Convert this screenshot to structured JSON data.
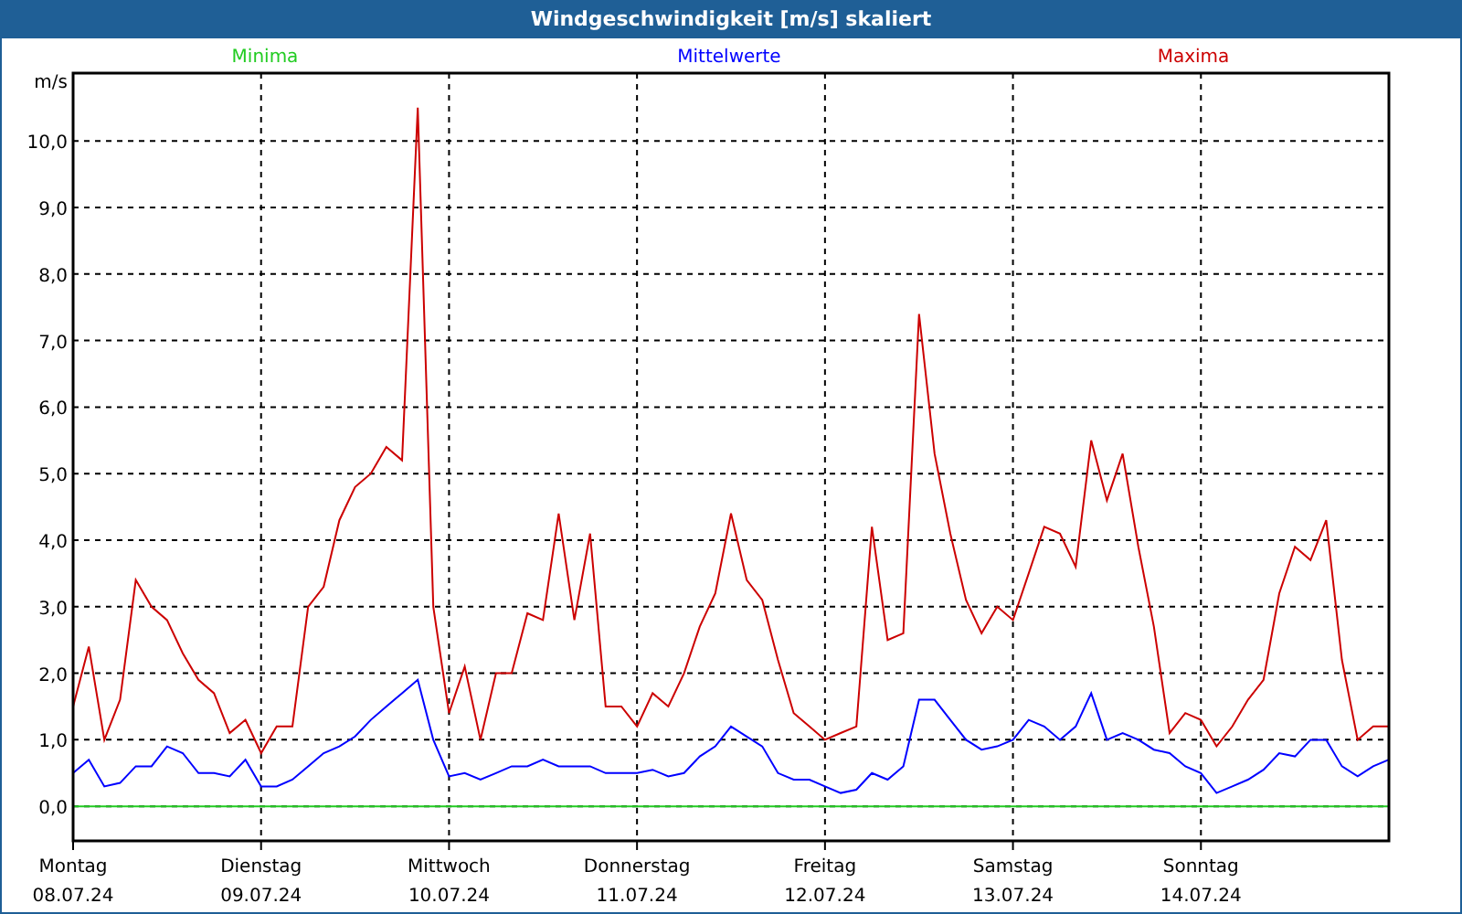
{
  "window": {
    "title": "Windgeschwindigkeit [m/s] skaliert"
  },
  "chart_data": {
    "type": "line",
    "ylabel": "m/s",
    "grid": true,
    "ylim": [
      -0.52,
      11.02
    ],
    "categories": [
      "Montag",
      null,
      null,
      null,
      null,
      null,
      null,
      null,
      null,
      null,
      null,
      null,
      "Dienstag",
      null,
      null,
      null,
      null,
      null,
      null,
      null,
      null,
      null,
      null,
      null,
      "Mittwoch",
      null,
      null,
      null,
      null,
      null,
      null,
      null,
      null,
      null,
      null,
      null,
      "Donnerstag",
      null,
      null,
      null,
      null,
      null,
      null,
      null,
      null,
      null,
      null,
      null,
      "Freitag",
      null,
      null,
      null,
      null,
      null,
      null,
      null,
      null,
      null,
      null,
      null,
      "Samstag",
      null,
      null,
      null,
      null,
      null,
      null,
      null,
      null,
      null,
      null,
      null,
      "Sonntag",
      null,
      null,
      null,
      null,
      null,
      null,
      null,
      null,
      null,
      null,
      null,
      null
    ],
    "yticks": [
      {
        "value": 0,
        "label": "0,0"
      },
      {
        "value": 1,
        "label": "1,0"
      },
      {
        "value": 2,
        "label": "2,0"
      },
      {
        "value": 3,
        "label": "3,0"
      },
      {
        "value": 4,
        "label": "4,0"
      },
      {
        "value": 5,
        "label": "5,0"
      },
      {
        "value": 6,
        "label": "6,0"
      },
      {
        "value": 7,
        "label": "7,0"
      },
      {
        "value": 8,
        "label": "8,0"
      },
      {
        "value": 9,
        "label": "9,0"
      },
      {
        "value": 10,
        "label": "10,0"
      }
    ],
    "series": [
      {
        "name": "Minima",
        "color": "#22cc22",
        "values": [
          0,
          0,
          0,
          0,
          0,
          0,
          0,
          0,
          0,
          0,
          0,
          0,
          0,
          0,
          0,
          0,
          0,
          0,
          0,
          0,
          0,
          0,
          0,
          0,
          0,
          0,
          0,
          0,
          0,
          0,
          0,
          0,
          0,
          0,
          0,
          0,
          0,
          0,
          0,
          0,
          0,
          0,
          0,
          0,
          0,
          0,
          0,
          0,
          0,
          0,
          0,
          0,
          0,
          0,
          0,
          0,
          0,
          0,
          0,
          0,
          0,
          0,
          0,
          0,
          0,
          0,
          0,
          0,
          0,
          0,
          0,
          0,
          0,
          0,
          0,
          0,
          0,
          0,
          0,
          0,
          0,
          0,
          0,
          0,
          0
        ]
      },
      {
        "name": "Mittelwerte",
        "color": "#0000ff",
        "values": [
          0.5,
          0.7,
          0.3,
          0.35,
          0.6,
          0.6,
          0.9,
          0.8,
          0.5,
          0.5,
          0.45,
          0.7,
          0.3,
          0.3,
          0.4,
          0.6,
          0.8,
          0.9,
          1.05,
          1.3,
          1.5,
          1.7,
          1.9,
          1.0,
          0.45,
          0.5,
          0.4,
          0.5,
          0.6,
          0.6,
          0.7,
          0.6,
          0.6,
          0.6,
          0.5,
          0.5,
          0.5,
          0.55,
          0.45,
          0.5,
          0.75,
          0.9,
          1.2,
          1.05,
          0.9,
          0.5,
          0.4,
          0.4,
          0.3,
          0.2,
          0.25,
          0.5,
          0.4,
          0.6,
          1.6,
          1.6,
          1.3,
          1.0,
          0.85,
          0.9,
          1.0,
          1.3,
          1.2,
          1.0,
          1.2,
          1.7,
          1.0,
          1.1,
          1.0,
          0.85,
          0.8,
          0.6,
          0.5,
          0.2,
          0.3,
          0.4,
          0.55,
          0.8,
          0.75,
          1.0,
          1.0,
          0.6,
          0.45,
          0.6,
          0.7
        ]
      },
      {
        "name": "Maxima",
        "color": "#cc0000",
        "values": [
          1.5,
          2.4,
          1.0,
          1.6,
          3.4,
          3.0,
          2.8,
          2.3,
          1.9,
          1.7,
          1.1,
          1.3,
          0.8,
          1.2,
          1.2,
          3.0,
          3.3,
          4.3,
          4.8,
          5.0,
          5.4,
          5.2,
          10.5,
          3.0,
          1.4,
          2.1,
          1.0,
          2.0,
          2.0,
          2.9,
          2.8,
          4.4,
          2.8,
          4.1,
          1.5,
          1.5,
          1.2,
          1.7,
          1.5,
          2.0,
          2.7,
          3.2,
          4.4,
          3.4,
          3.1,
          2.2,
          1.4,
          1.2,
          1.0,
          1.1,
          1.2,
          4.2,
          2.5,
          2.6,
          7.4,
          5.3,
          4.1,
          3.1,
          2.6,
          3.0,
          2.8,
          3.5,
          4.2,
          4.1,
          3.6,
          5.5,
          4.6,
          5.3,
          3.9,
          2.7,
          1.1,
          1.4,
          1.3,
          0.9,
          1.2,
          1.6,
          1.9,
          3.2,
          3.9,
          3.7,
          4.3,
          2.2,
          1.0,
          1.2,
          1.2
        ]
      }
    ]
  },
  "date_labels": [
    "08.07.24",
    "09.07.24",
    "10.07.24",
    "11.07.24",
    "12.07.24",
    "13.07.24",
    "14.07.24"
  ]
}
